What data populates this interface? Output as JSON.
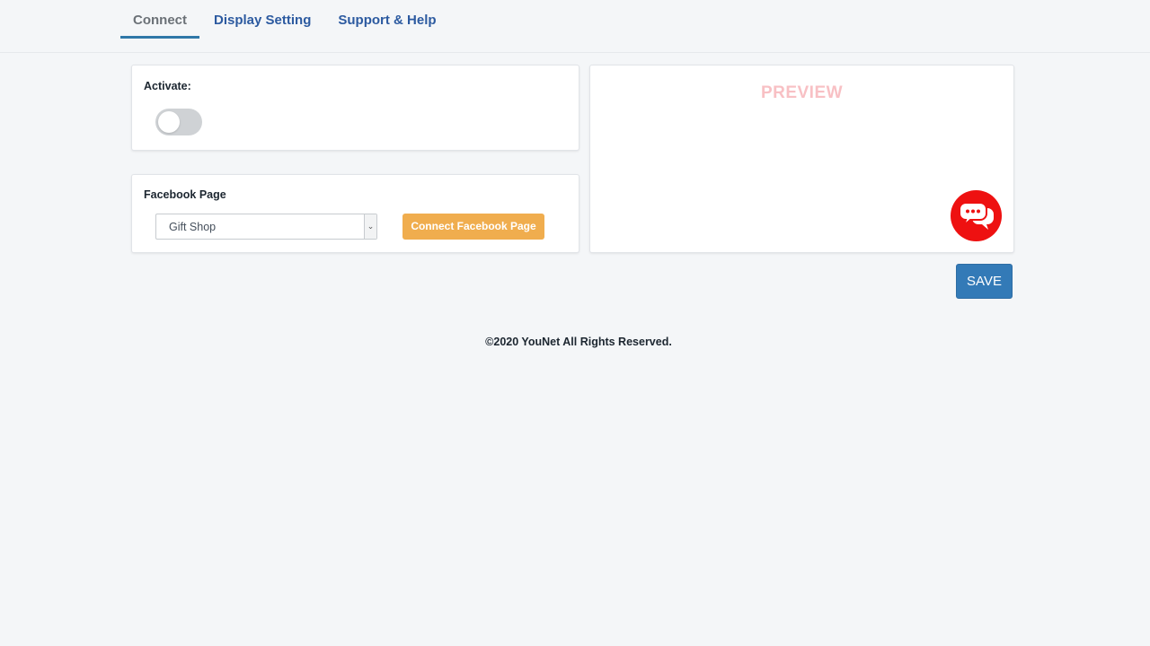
{
  "tabs": [
    {
      "label": "Connect",
      "active": true
    },
    {
      "label": "Display Setting",
      "active": false
    },
    {
      "label": "Support & Help",
      "active": false
    }
  ],
  "activate": {
    "label": "Activate:",
    "enabled": false
  },
  "facebook": {
    "label": "Facebook Page",
    "selected_page": "Gift Shop",
    "connect_button": "Connect Facebook Page"
  },
  "preview": {
    "title": "PREVIEW",
    "bubble_icon": "chat-bubbles-icon"
  },
  "save_button": "SAVE",
  "footer": "©2020 YouNet All Rights Reserved.",
  "colors": {
    "tab_link": "#2c5aa0",
    "tab_active_underline": "#2f78a8",
    "connect_button": "#f0ad4e",
    "save_button": "#337ab7",
    "chat_bubble": "#ee1111",
    "preview_title": "#f8c0c4"
  }
}
